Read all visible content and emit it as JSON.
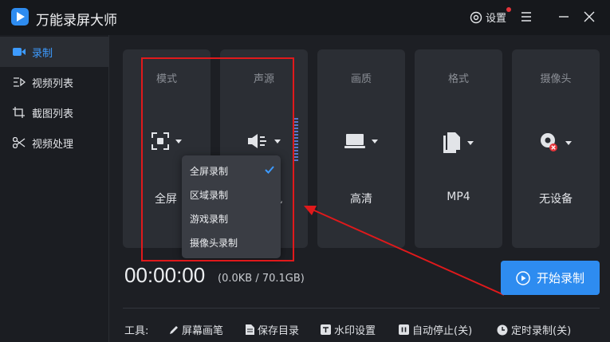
{
  "app": {
    "title": "万能录屏大师",
    "accent": "#2e8cf0",
    "settings_label": "设置"
  },
  "sidebar": {
    "items": [
      {
        "label": "录制",
        "icon": "video-camera-icon"
      },
      {
        "label": "视频列表",
        "icon": "video-list-icon"
      },
      {
        "label": "截图列表",
        "icon": "screenshot-list-icon"
      },
      {
        "label": "视频处理",
        "icon": "video-edit-icon"
      }
    ]
  },
  "cards": [
    {
      "heading": "模式",
      "value": "全屏",
      "icon": "fullscreen-icon"
    },
    {
      "heading": "声源",
      "value": "风",
      "icon": "speaker-icon"
    },
    {
      "heading": "画质",
      "value": "高清",
      "icon": "monitor-icon"
    },
    {
      "heading": "格式",
      "value": "MP4",
      "icon": "file-icon"
    },
    {
      "heading": "摄像头",
      "value": "无设备",
      "icon": "webcam-disabled-icon"
    }
  ],
  "mode_dropdown": {
    "items": [
      "全屏录制",
      "区域录制",
      "游戏录制",
      "摄像头录制"
    ],
    "selected": "全屏录制"
  },
  "timer": {
    "elapsed": "00:00:00",
    "size": "(0.0KB / 70.1GB)"
  },
  "start_button": {
    "label": "开始录制"
  },
  "toolbar": {
    "label": "工具:",
    "items": [
      "屏幕画笔",
      "保存目录",
      "水印设置",
      "自动停止(关)",
      "定时录制(关)"
    ]
  }
}
